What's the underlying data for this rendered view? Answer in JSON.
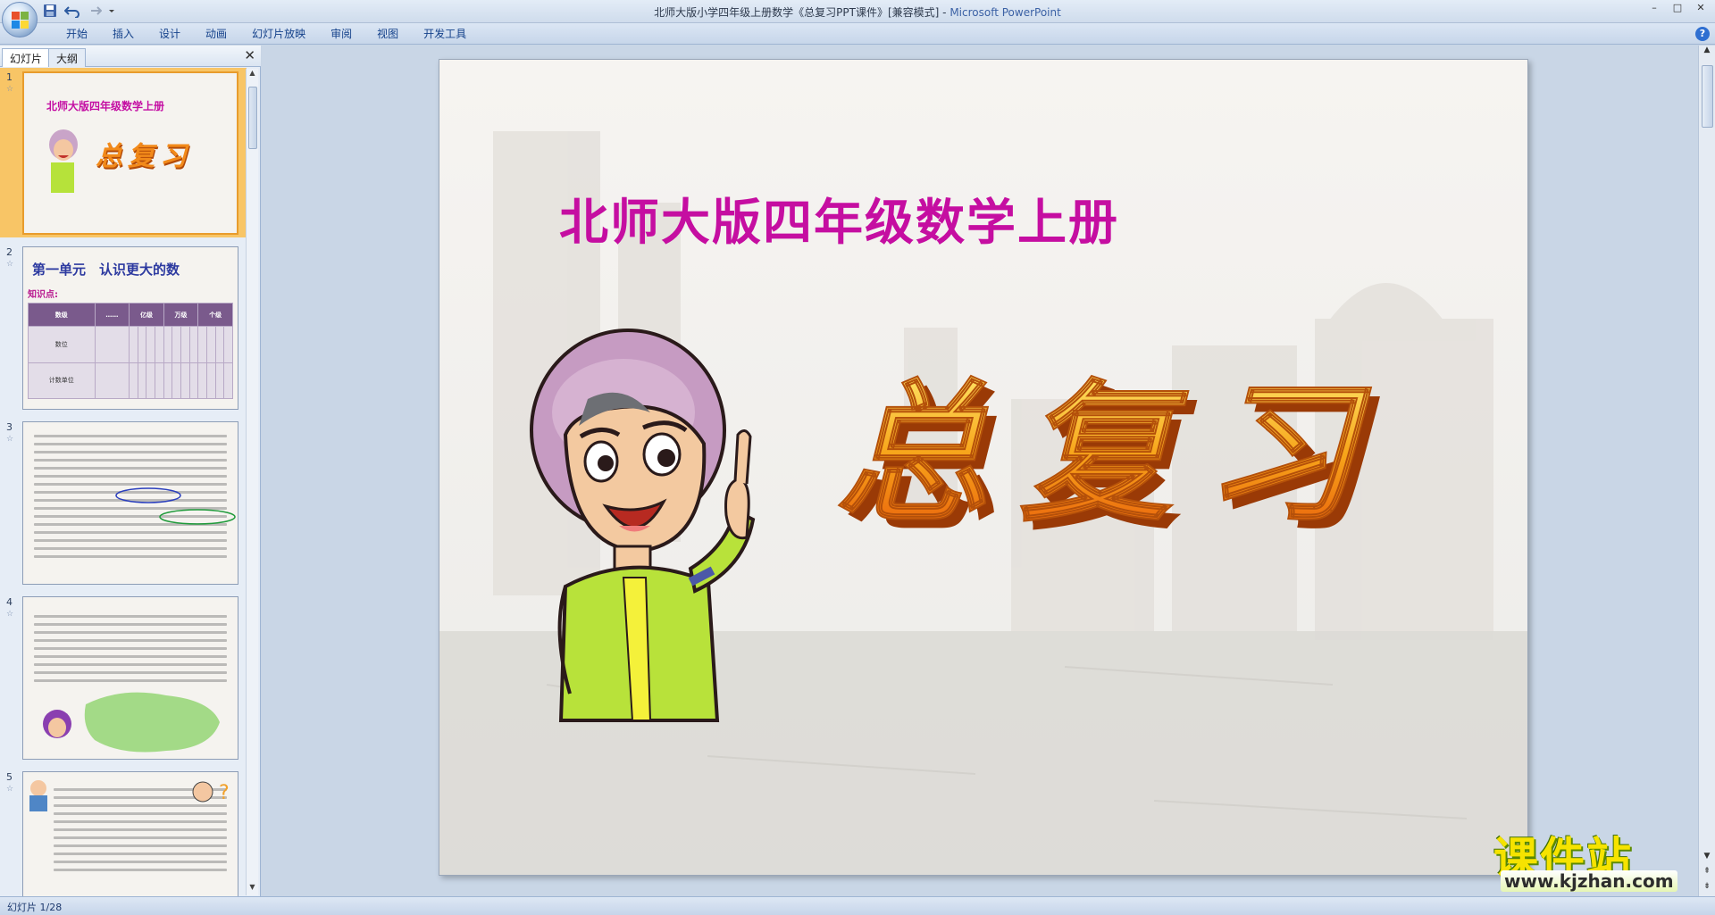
{
  "window": {
    "title": "北师大版小学四年级上册数学《总复习PPT课件》[兼容模式] - ",
    "app_name": "Microsoft PowerPoint",
    "controls": [
      "–",
      "□",
      "✕"
    ]
  },
  "menu": {
    "tabs": [
      "开始",
      "插入",
      "设计",
      "动画",
      "幻灯片放映",
      "审阅",
      "视图",
      "开发工具"
    ],
    "help": "?"
  },
  "pane": {
    "tab_slides": "幻灯片",
    "tab_outline": "大纲",
    "close": "✕"
  },
  "thumbnails": [
    {
      "num": "1",
      "title": "北师大版四年级数学上册",
      "wordart": "总复习"
    },
    {
      "num": "2",
      "title": "第一单元　认识更大的数",
      "kp": "知识点:",
      "header": [
        "数级",
        "……",
        "亿级",
        "万级",
        "个级"
      ],
      "row1_label": "数位",
      "row2_label": "计数单位"
    },
    {
      "num": "3"
    },
    {
      "num": "4"
    },
    {
      "num": "5"
    }
  ],
  "slide": {
    "title": "北师大版四年级数学上册",
    "wordart": "总复习"
  },
  "watermark": {
    "text": "课件站",
    "url": "www.kjzhan.com"
  },
  "status": {
    "slide_counter": "幻灯片 1/28"
  },
  "colors": {
    "title_magenta": "#c50ea1",
    "wordart_orange": "#f28a1a",
    "ribbon_text": "#15428b"
  }
}
